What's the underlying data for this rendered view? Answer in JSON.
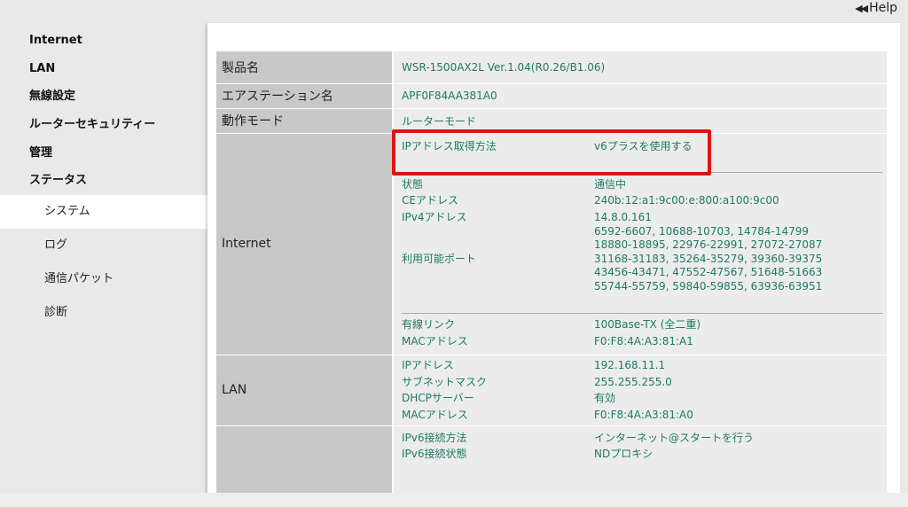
{
  "header": {
    "help_label": "Help",
    "help_icon": "double-left-arrow-icon"
  },
  "sidebar": {
    "top_items": [
      {
        "label": "Internet"
      },
      {
        "label": "LAN"
      },
      {
        "label": "無線設定"
      },
      {
        "label": "ルーターセキュリティー"
      },
      {
        "label": "管理"
      },
      {
        "label": "ステータス"
      }
    ],
    "sub_items": [
      {
        "label": "システム",
        "active": true
      },
      {
        "label": "ログ"
      },
      {
        "label": "通信パケット"
      },
      {
        "label": "診断"
      }
    ]
  },
  "status": {
    "product_name": {
      "label": "製品名",
      "value": "WSR-1500AX2L Ver.1.04(R0.26/B1.06)"
    },
    "station_name": {
      "label": "エアステーション名",
      "value": "APF0F84AA381A0"
    },
    "mode": {
      "label": "動作モード",
      "value": "ルーターモード"
    },
    "internet": {
      "label": "Internet",
      "ip_method": {
        "key": "IPアドレス取得方法",
        "value": "v6プラスを使用する"
      },
      "state": {
        "key": "状態",
        "value": "通信中"
      },
      "ce_address": {
        "key": "CEアドレス",
        "value": "240b:12:a1:9c00:e:800:a100:9c00"
      },
      "ipv4": {
        "key": "IPv4アドレス",
        "value": "14.8.0.161"
      },
      "ports": {
        "key": "利用可能ポート",
        "lines": [
          "6592-6607, 10688-10703, 14784-14799",
          "18880-18895, 22976-22991, 27072-27087",
          "31168-31183, 35264-35279, 39360-39375",
          "43456-43471, 47552-47567, 51648-51663",
          "55744-55759, 59840-59855, 63936-63951"
        ]
      },
      "wired_link": {
        "key": "有線リンク",
        "value": "100Base-TX (全二重)"
      },
      "mac": {
        "key": "MACアドレス",
        "value": "F0:F8:4A:A3:81:A1"
      }
    },
    "lan": {
      "label": "LAN",
      "ip": {
        "key": "IPアドレス",
        "value": "192.168.11.1"
      },
      "subnet": {
        "key": "サブネットマスク",
        "value": "255.255.255.0"
      },
      "dhcp": {
        "key": "DHCPサーバー",
        "value": "有効"
      },
      "mac": {
        "key": "MACアドレス",
        "value": "F0:F8:4A:A3:81:A0"
      }
    },
    "ipv6": {
      "connect_method": {
        "key": "IPv6接続方法",
        "value": "インターネット@スタートを行う"
      },
      "connect_state": {
        "key": "IPv6接続状態",
        "value": "NDプロキシ"
      }
    }
  },
  "colors": {
    "value_text": "#1e7a64",
    "highlight_border": "#e01212",
    "header_cell": "#c8c8c8"
  }
}
